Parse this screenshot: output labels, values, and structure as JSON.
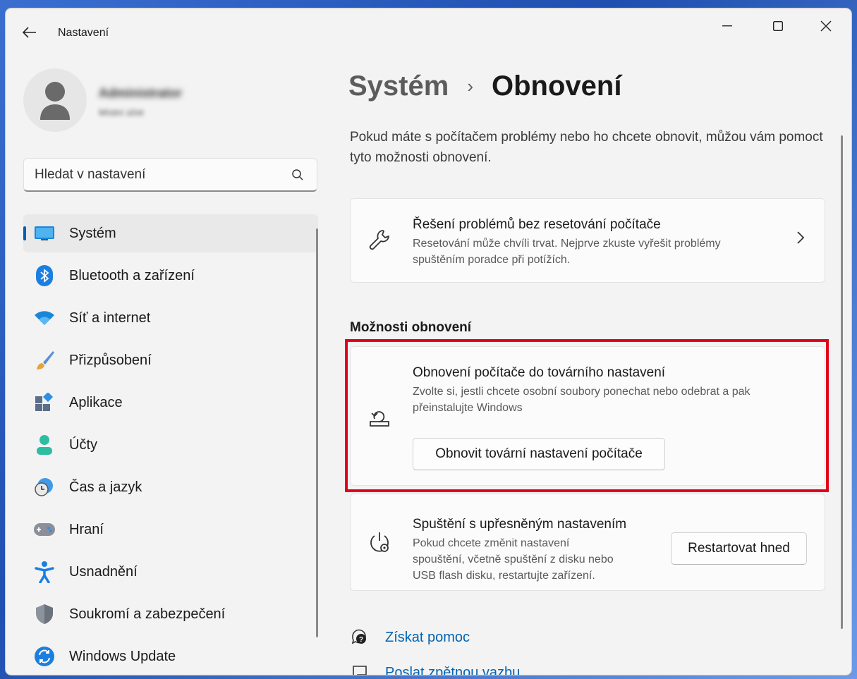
{
  "window": {
    "title": "Nastavení"
  },
  "user": {
    "name": "Administrator",
    "subtitle": "Místní účet"
  },
  "search": {
    "placeholder": "Hledat v nastavení"
  },
  "sidebar": {
    "items": [
      {
        "label": "Systém",
        "icon": "system-icon",
        "active": true
      },
      {
        "label": "Bluetooth a zařízení",
        "icon": "bluetooth-icon"
      },
      {
        "label": "Síť a internet",
        "icon": "wifi-icon"
      },
      {
        "label": "Přizpůsobení",
        "icon": "brush-icon"
      },
      {
        "label": "Aplikace",
        "icon": "apps-icon"
      },
      {
        "label": "Účty",
        "icon": "account-icon"
      },
      {
        "label": "Čas a jazyk",
        "icon": "time-language-icon"
      },
      {
        "label": "Hraní",
        "icon": "gamepad-icon"
      },
      {
        "label": "Usnadnění",
        "icon": "accessibility-icon"
      },
      {
        "label": "Soukromí a zabezpečení",
        "icon": "shield-icon"
      },
      {
        "label": "Windows Update",
        "icon": "update-icon"
      }
    ]
  },
  "main": {
    "breadcrumb_parent": "Systém",
    "breadcrumb_sep": "›",
    "breadcrumb_current": "Obnovení",
    "intro": "Pokud máte s počítačem problémy nebo ho chcete obnovit, můžou vám pomoct tyto možnosti obnovení.",
    "troubleshoot": {
      "title": "Řešení problémů bez resetování počítače",
      "desc_line1": "Resetování může chvíli trvat. Nejprve zkuste vyřešit problémy",
      "desc_line2": "spuštěním poradce při potížích."
    },
    "section_title": "Možnosti obnovení",
    "reset": {
      "title": "Obnovení počítače do továrního nastavení",
      "desc_line1": "Zvolte si, jestli chcete osobní soubory ponechat nebo odebrat a pak",
      "desc_line2": "přeinstalujte Windows",
      "button": "Obnovit tovární nastavení počítače"
    },
    "advanced": {
      "title": "Spuštění s upřesněným nastavením",
      "desc_line1": "Pokud chcete změnit nastavení",
      "desc_line2": "spouštění, včetně spuštění z disku nebo",
      "desc_line3": "USB flash disku, restartujte zařízení.",
      "button": "Restartovat hned"
    },
    "links": {
      "help": "Získat pomoc",
      "feedback": "Poslat zpětnou vazbu"
    }
  },
  "colors": {
    "accent": "#005fb8",
    "highlight_border": "#e3001b",
    "link": "#0063b1"
  }
}
